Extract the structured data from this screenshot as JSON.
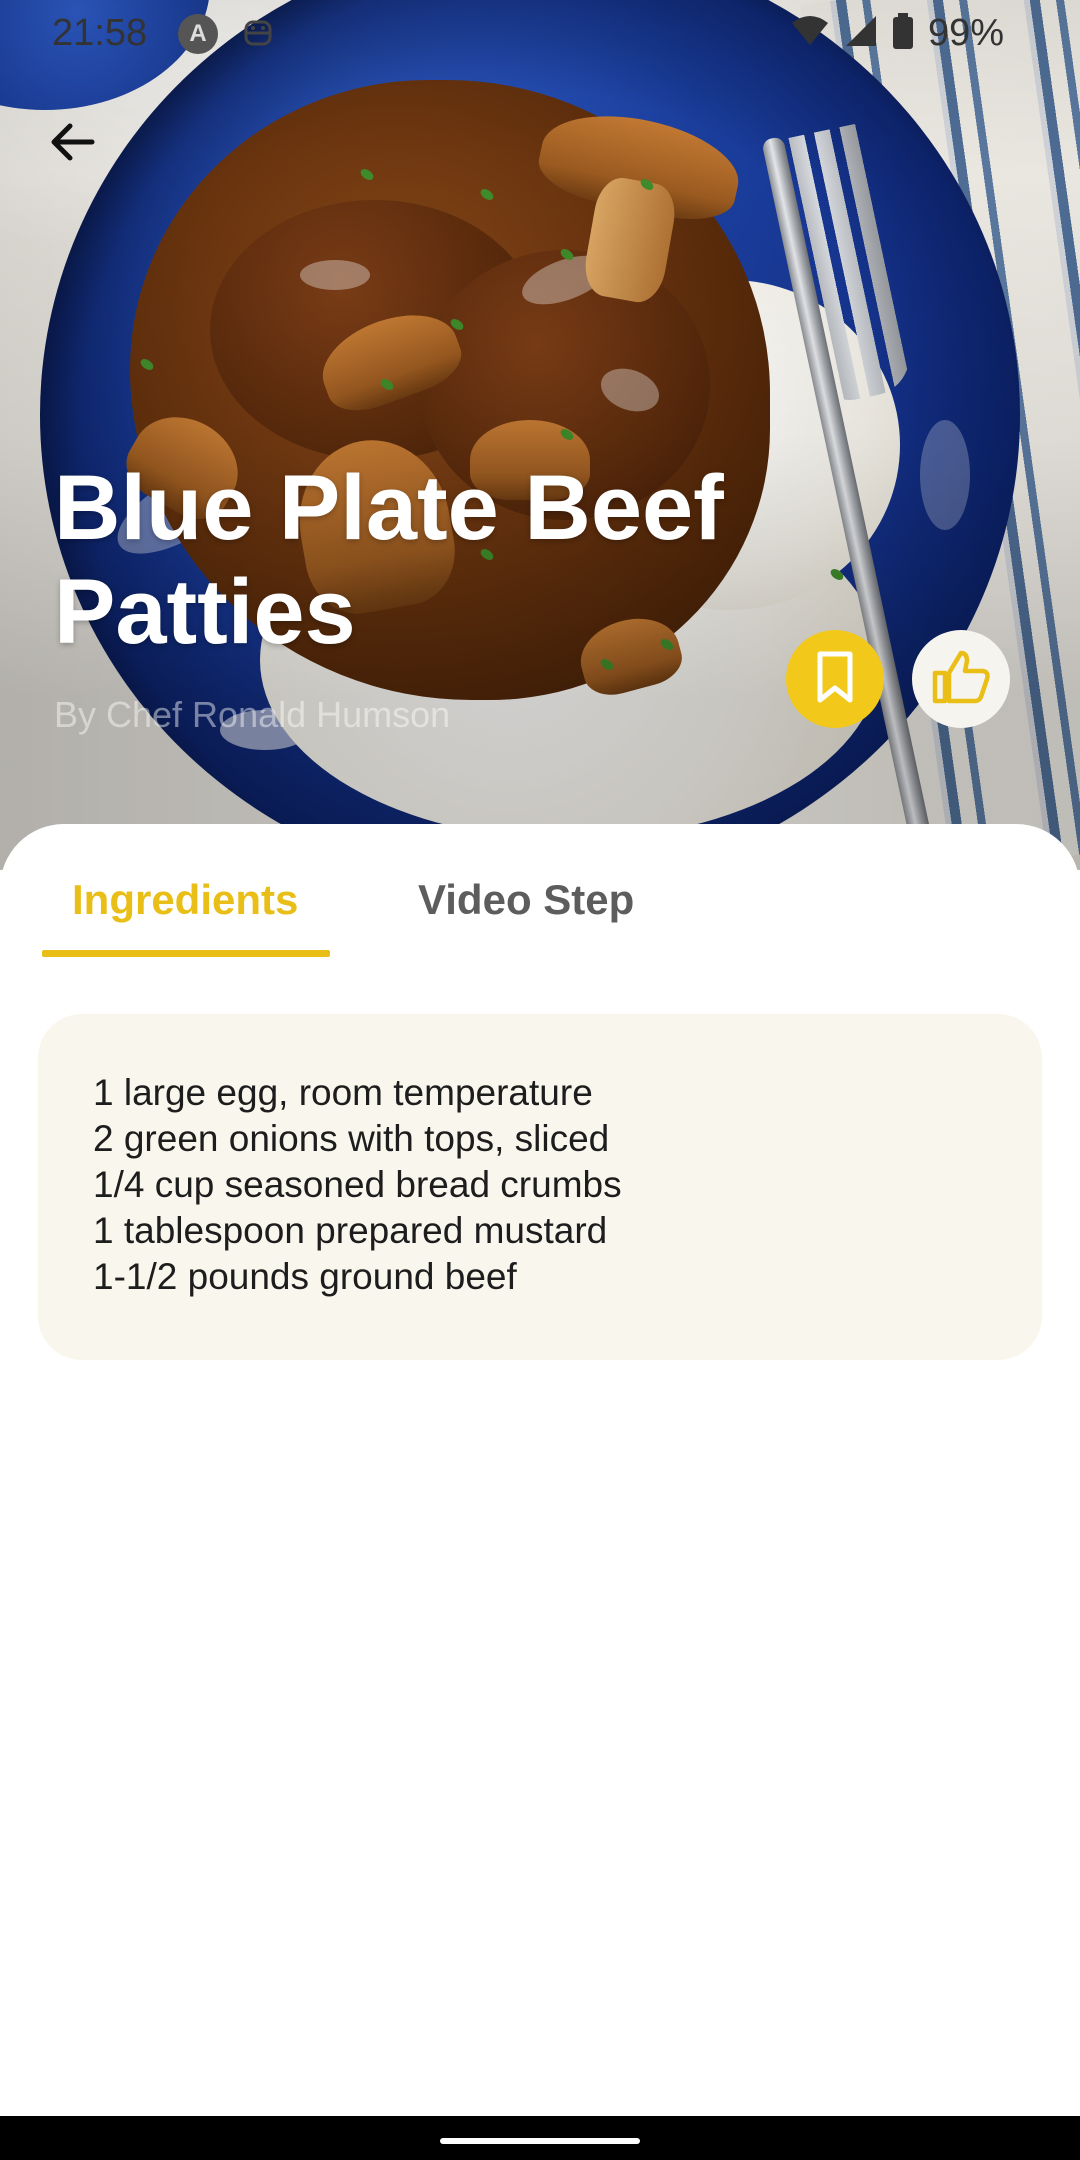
{
  "status_bar": {
    "time": "21:58",
    "battery": "99%",
    "icons": [
      "a-circle-icon",
      "robot-icon",
      "wifi-icon",
      "cell-signal-icon",
      "battery-icon"
    ]
  },
  "top_bar": {
    "back_icon": "arrow-left-icon"
  },
  "recipe": {
    "title": "Blue Plate Beef Patties",
    "byline": "By Chef Ronald Humson"
  },
  "actions": {
    "bookmark_icon": "bookmark-icon",
    "like_icon": "thumbs-up-icon"
  },
  "tabs": [
    {
      "label": "Ingredients",
      "selected": true
    },
    {
      "label": "Video Step",
      "selected": false
    }
  ],
  "ingredients": [
    "1 large egg, room temperature",
    "2 green onions with tops, sliced",
    "1/4 cup seasoned bread crumbs",
    "1 tablespoon prepared mustard",
    "1-1/2 pounds ground beef"
  ],
  "colors": {
    "accent": "#e9be16",
    "bookmark_bg": "#f2c81a",
    "card_bg": "#f8f6ed",
    "tab_inactive": "#5d5d5d"
  }
}
